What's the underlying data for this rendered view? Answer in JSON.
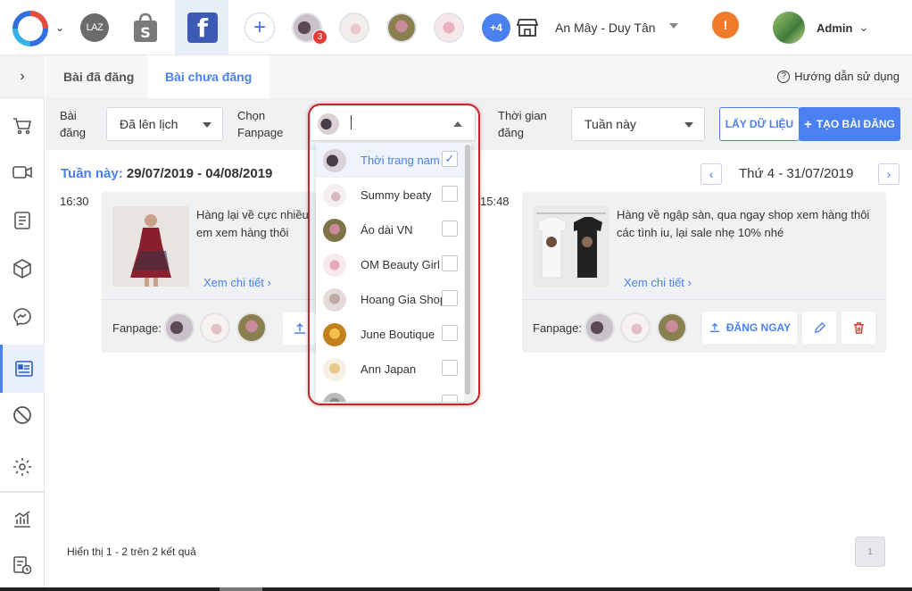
{
  "topbar": {
    "laz_label": "LAZ",
    "notif_count": "3",
    "more_pages": "+4",
    "store_name": "An Mây - Duy Tân",
    "warning_symbol": "!",
    "user_name": "Admin",
    "brand_color": "#4a80f0",
    "warn_color": "#f07b2a"
  },
  "tabs": {
    "posted": "Bài đã đăng",
    "unposted": "Bài chưa đăng",
    "help": "Hướng dẫn sử dụng"
  },
  "filters": {
    "post_label_1": "Bài",
    "post_label_2": "đăng",
    "post_status": "Đã lên lịch",
    "fanpage_label_1": "Chọn",
    "fanpage_label_2": "Fanpage",
    "time_label_1": "Thời gian",
    "time_label_2": "đăng",
    "time_value": "Tuần này",
    "fetch_button": "LẤY DỮ LIỆU",
    "create_button": "TẠO BÀI ĐĂNG"
  },
  "week": {
    "label": "Tuần này:",
    "range": "29/07/2019 - 04/08/2019",
    "day": "Thứ 4 - 31/07/2019"
  },
  "posts": [
    {
      "time": "16:30",
      "text_line1": "Hàng lại về cực nhiều",
      "text_line2": "em xem hàng thôi",
      "more": "Xem chi tiết",
      "fanpage_label": "Fanpage:"
    },
    {
      "time": "15:48",
      "text_line1": "Hàng về ngập sàn, qua ngay shop xem hàng thôi",
      "text_line2": "các tình iu, lại sale nhẹ 10% nhé",
      "more": "Xem chi tiết",
      "fanpage_label": "Fanpage:",
      "post_now": "ĐĂNG NGAY"
    }
  ],
  "dropdown": {
    "items": [
      {
        "label": "Thời trang nam",
        "checked": true,
        "mark": "✓"
      },
      {
        "label": "Summy beaty",
        "checked": false
      },
      {
        "label": "Áo dài VN",
        "checked": false
      },
      {
        "label": "OM Beauty Girl",
        "checked": false
      },
      {
        "label": "Hoang Gia Shop",
        "checked": false
      },
      {
        "label": "June Boutique",
        "checked": false
      },
      {
        "label": "Ann Japan",
        "checked": false
      }
    ]
  },
  "pager": {
    "info": "Hiển thị 1 - 2 trên 2 kết quả",
    "page": "1"
  }
}
